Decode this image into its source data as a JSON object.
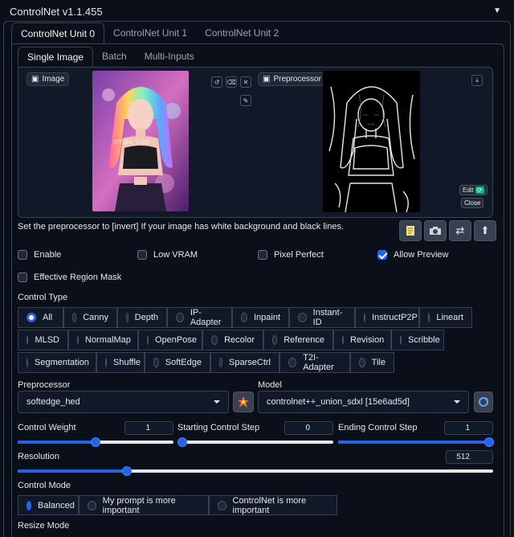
{
  "header": {
    "title": "ControlNet v1.1.455",
    "collapse_icon": "triangle-down"
  },
  "unit_tabs": [
    {
      "label": "ControlNet Unit 0",
      "active": true
    },
    {
      "label": "ControlNet Unit 1",
      "active": false
    },
    {
      "label": "ControlNet Unit 2",
      "active": false
    }
  ],
  "mode_tabs": [
    {
      "label": "Single Image",
      "active": true
    },
    {
      "label": "Batch",
      "active": false
    },
    {
      "label": "Multi-Inputs",
      "active": false
    }
  ],
  "image_panel": {
    "label": "Image",
    "preprocessor_preview_label": "Preprocessor Preview",
    "edit_label": "Edit",
    "close_label": "Close",
    "watermark": "©Yuka_Luvs"
  },
  "note": "Set the preprocessor to [invert] If your image has white background and black lines.",
  "toolbar": {
    "icons": [
      "notepad-icon",
      "camera-icon",
      "swap-icon",
      "upload-arrow-icon"
    ]
  },
  "checkboxes": [
    {
      "label": "Enable",
      "checked": false
    },
    {
      "label": "Low VRAM",
      "checked": false
    },
    {
      "label": "Pixel Perfect",
      "checked": false
    },
    {
      "label": "Allow Preview",
      "checked": true
    },
    {
      "label": "Effective Region Mask",
      "checked": false
    }
  ],
  "control_type": {
    "label": "Control Type",
    "selected": "All",
    "options": [
      "All",
      "Canny",
      "Depth",
      "IP-Adapter",
      "Inpaint",
      "Instant-ID",
      "InstructP2P",
      "Lineart",
      "MLSD",
      "NormalMap",
      "OpenPose",
      "Recolor",
      "Reference",
      "Revision",
      "Scribble",
      "Segmentation",
      "Shuffle",
      "SoftEdge",
      "SparseCtrl",
      "T2I-Adapter",
      "Tile"
    ]
  },
  "preprocessor": {
    "label": "Preprocessor",
    "value": "softedge_hed",
    "run_icon": "explosion-icon"
  },
  "model": {
    "label": "Model",
    "value": "controlnet++_union_sdxl [15e6ad5d]",
    "refresh_icon": "refresh-icon"
  },
  "control_weight": {
    "label": "Control Weight",
    "value": "1",
    "fraction": 0.5
  },
  "starting_step": {
    "label": "Starting Control Step",
    "value": "0",
    "fraction": 0.0
  },
  "ending_step": {
    "label": "Ending Control Step",
    "value": "1",
    "fraction": 1.0
  },
  "resolution": {
    "label": "Resolution",
    "value": "512",
    "fraction": 0.23
  },
  "control_mode": {
    "label": "Control Mode",
    "selected": "Balanced",
    "options": [
      "Balanced",
      "My prompt is more important",
      "ControlNet is more important"
    ]
  },
  "resize_mode": {
    "label": "Resize Mode"
  },
  "colors": {
    "accent": "#2563eb",
    "background": "#0b0f19",
    "panel": "#111827",
    "border": "#374151"
  }
}
